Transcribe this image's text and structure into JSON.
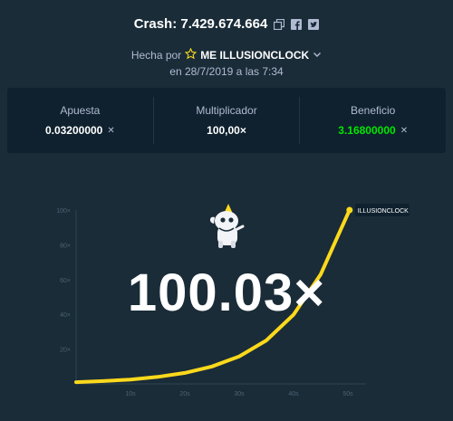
{
  "header": {
    "title": "Crash: 7.429.674.664",
    "copy_icon": "copy-icon",
    "facebook_icon": "facebook-icon",
    "twitter_icon": "twitter-icon"
  },
  "byline": {
    "prefix": "Hecha por",
    "star_icon": "star-icon",
    "user": "ME ILLUSIONCLOCK",
    "chevron_icon": "chevron-down-icon",
    "date": "en 28/7/2019 a las 7:34"
  },
  "stats": {
    "bet": {
      "label": "Apuesta",
      "value": "0.03200000"
    },
    "multiplier": {
      "label": "Multiplicador",
      "value": "100,00×"
    },
    "profit": {
      "label": "Beneficio",
      "value": "3.16800000"
    }
  },
  "colors": {
    "background": "#1a2c38",
    "panel": "#0f212e",
    "curve": "#fdd91c",
    "profit_green": "#00e701",
    "muted": "#b1bad3"
  },
  "game": {
    "multiplier_display": "100.03×",
    "player_tag": "ILLUSIONCLOCK",
    "mascot_icon": "unicorn-mascot-icon"
  },
  "chart_data": {
    "type": "line",
    "title": "",
    "xlabel": "",
    "ylabel": "",
    "x_ticks": [
      "10s",
      "20s",
      "30s",
      "40s",
      "50s"
    ],
    "y_ticks": [
      "20×",
      "40×",
      "60×",
      "80×",
      "100×"
    ],
    "xlim": [
      0,
      52
    ],
    "ylim": [
      0,
      100
    ],
    "series": [
      {
        "values": [
          [
            0,
            1
          ],
          [
            5,
            1.6
          ],
          [
            10,
            2.5
          ],
          [
            15,
            4
          ],
          [
            20,
            6.3
          ],
          [
            25,
            10
          ],
          [
            30,
            15.8
          ],
          [
            35,
            25
          ],
          [
            40,
            39.8
          ],
          [
            45,
            63
          ],
          [
            48,
            84
          ],
          [
            50.3,
            100
          ]
        ]
      }
    ]
  }
}
